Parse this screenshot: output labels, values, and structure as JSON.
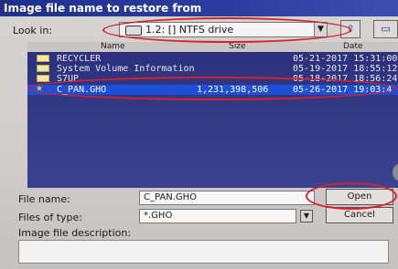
{
  "window": {
    "title": "Image file name to restore from"
  },
  "look_in": {
    "label": "Look in:",
    "value": "1.2: [] NTFS drive"
  },
  "toolbar": {
    "up_icon": "up-folder-icon",
    "new_icon": "new-folder-icon"
  },
  "file_list": {
    "columns": [
      "Name",
      "Size",
      "Date"
    ],
    "rows": [
      {
        "name": "RECYCLER",
        "size": "",
        "date": "05-21-2017 15:31:00",
        "type": "folder"
      },
      {
        "name": "System Volume Information",
        "size": "",
        "date": "05-19-2017 18:55:12",
        "type": "folder"
      },
      {
        "name": "S7UP",
        "size": "",
        "date": "05-18-2017 18:56:24",
        "type": "folder"
      },
      {
        "name": "C_PAN.GHO",
        "size": "1,231,398,506",
        "date": "05-26-2017 19:03:4",
        "type": "file",
        "selected": true
      }
    ]
  },
  "file_name": {
    "label": "File name:",
    "value": "C_PAN.GHO"
  },
  "files_of_type": {
    "label": "Files of type:",
    "value": "*.GHO"
  },
  "description": {
    "label": "Image file description:"
  },
  "buttons": {
    "open": "Open",
    "cancel": "Cancel"
  },
  "colors": {
    "title_bar": "#2a3fa0",
    "list_bg": "#333a86",
    "selection": "#1e4fd8",
    "annotation": "#d8202a"
  }
}
